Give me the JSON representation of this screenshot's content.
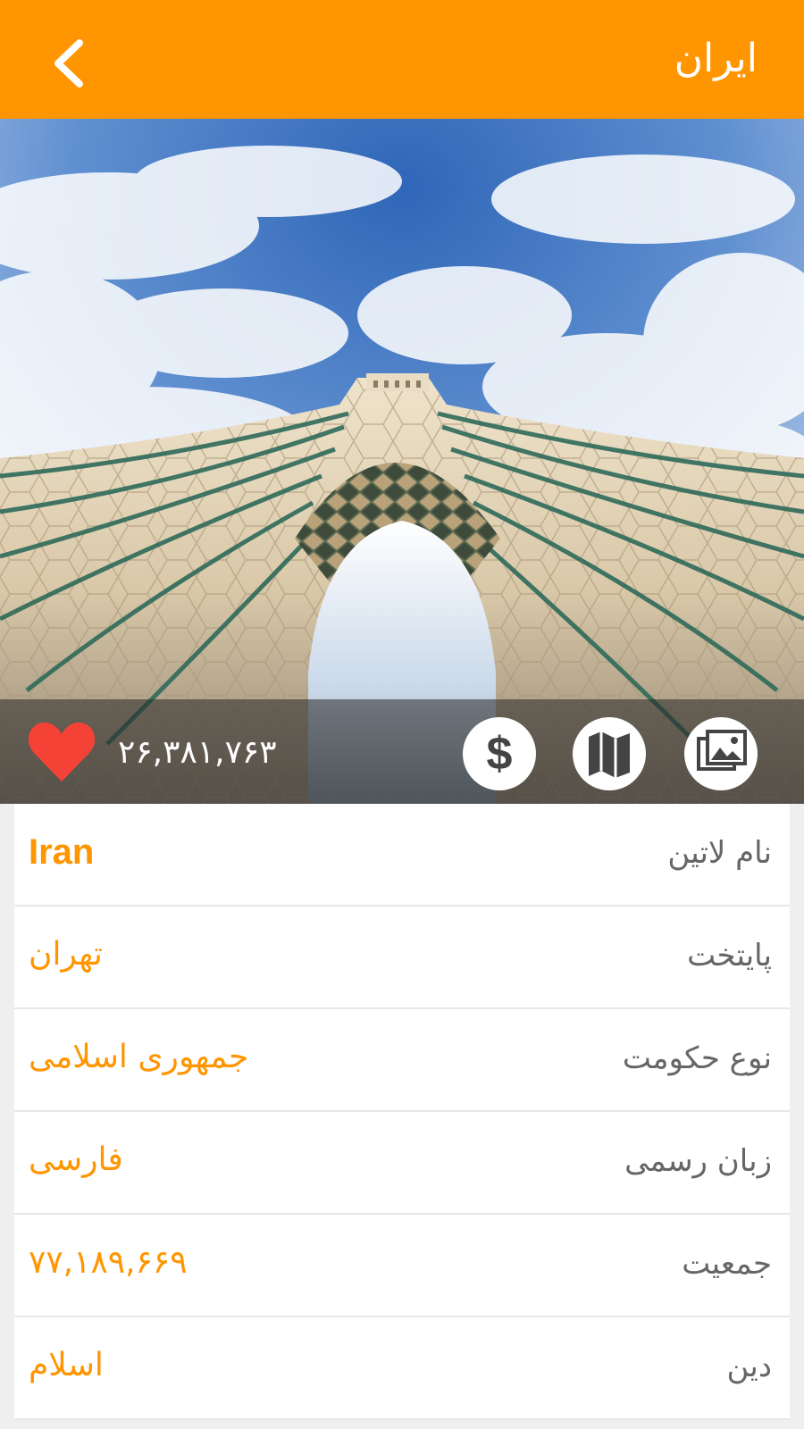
{
  "header": {
    "title": "ایران",
    "back_icon": "chevron-left-icon",
    "background_color": "#ff9500"
  },
  "hero": {
    "photo_subject": "Azadi Tower under cloudy sky",
    "likes_count": "۲۶,۳۸۱,۷۶۳",
    "heart_color": "#f44336",
    "actions": [
      {
        "name": "currency",
        "icon": "dollar-icon"
      },
      {
        "name": "map",
        "icon": "map-icon"
      },
      {
        "name": "gallery",
        "icon": "image-gallery-icon"
      }
    ]
  },
  "info": {
    "accent_color": "#ff9500",
    "rows": [
      {
        "label": "نام لاتین",
        "value": "Iran"
      },
      {
        "label": "پایتخت",
        "value": "تهران"
      },
      {
        "label": "نوع حکومت",
        "value": "جمهوری اسلامی"
      },
      {
        "label": "زبان رسمی",
        "value": "فارسی"
      },
      {
        "label": "جمعیت",
        "value": "۷۷,۱۸۹,۶۶۹"
      },
      {
        "label": "دین",
        "value": "اسلام"
      }
    ]
  }
}
